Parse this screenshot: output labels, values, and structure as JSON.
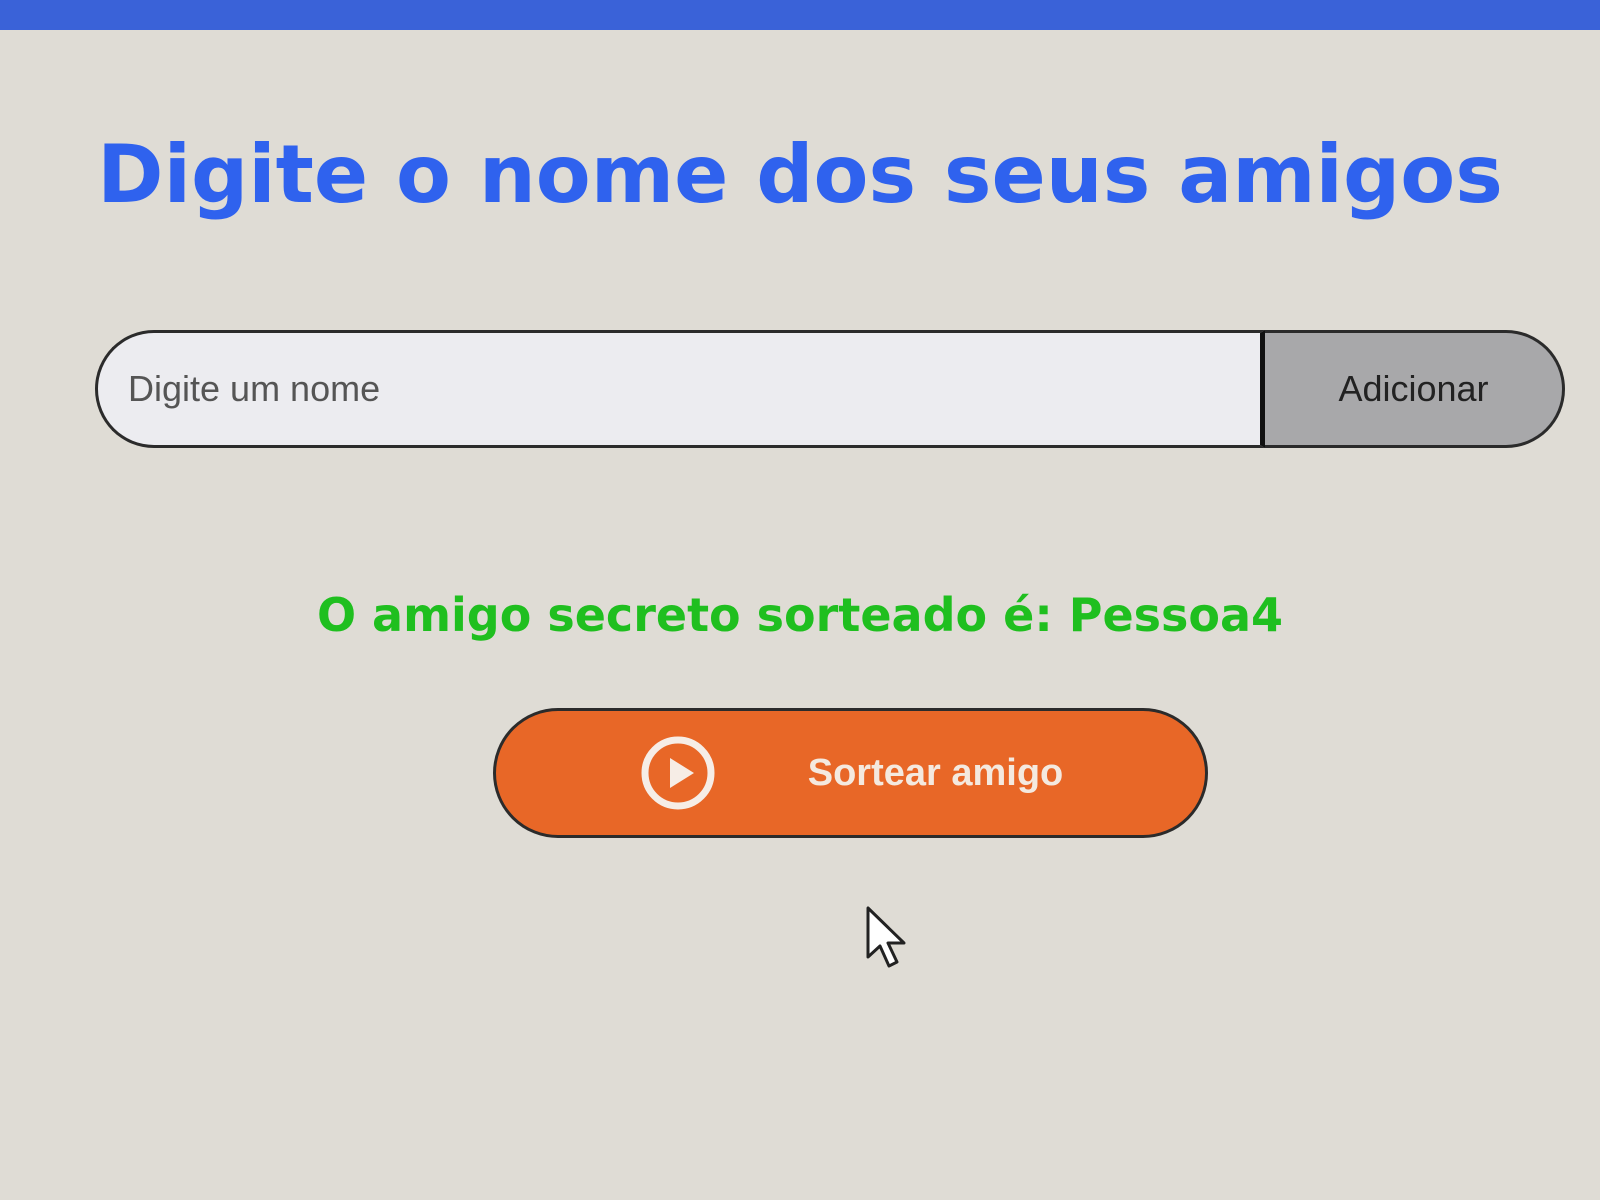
{
  "page": {
    "title": "Digite o nome dos seus amigos"
  },
  "form": {
    "input_placeholder": "Digite um nome",
    "input_value": "",
    "add_button_label": "Adicionar"
  },
  "result": {
    "text": "O amigo secreto sorteado é: Pessoa4"
  },
  "draw_button": {
    "label": "Sortear amigo",
    "icon": "play-circle-icon"
  },
  "cursor": {
    "icon": "mouse-pointer-icon"
  },
  "colors": {
    "title": "#2f62ee",
    "result": "#1fbf1f",
    "draw_button": "#e86727",
    "add_button": "#a8a8aa",
    "background": "#dfdcd5",
    "top_strip": "#3a62d8"
  }
}
